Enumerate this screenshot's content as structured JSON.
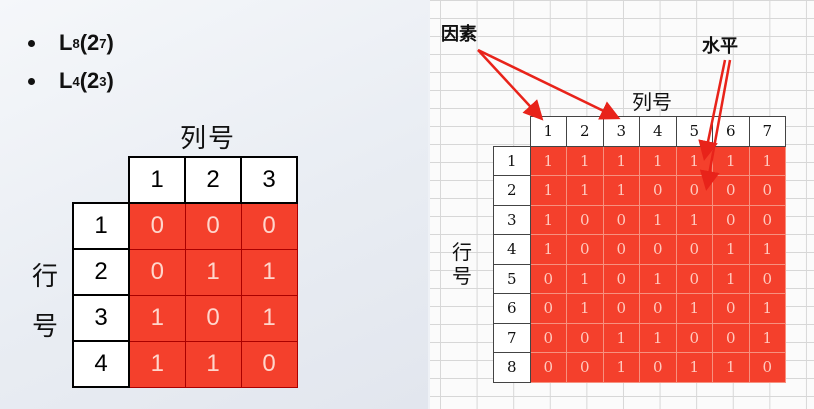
{
  "left": {
    "bullets": [
      {
        "base": "L",
        "sub": "8",
        "paren_base": "2",
        "sup": "7"
      },
      {
        "base": "L",
        "sub": "4",
        "paren_base": "2",
        "sup": "3"
      }
    ],
    "table_title": "列号",
    "row_label_1": "行",
    "row_label_2": "号",
    "columns": [
      "1",
      "2",
      "3"
    ],
    "rows": [
      {
        "id": "1",
        "values": [
          "0",
          "0",
          "0"
        ]
      },
      {
        "id": "2",
        "values": [
          "0",
          "1",
          "1"
        ]
      },
      {
        "id": "3",
        "values": [
          "1",
          "0",
          "1"
        ]
      },
      {
        "id": "4",
        "values": [
          "1",
          "1",
          "0"
        ]
      }
    ]
  },
  "right": {
    "factor_label": "因素",
    "level_label": "水平",
    "table_title": "列号",
    "row_label": "行号",
    "columns": [
      "1",
      "2",
      "3",
      "4",
      "5",
      "6",
      "7"
    ],
    "rows": [
      {
        "id": "1",
        "values": [
          "1",
          "1",
          "1",
          "1",
          "1",
          "1",
          "1"
        ]
      },
      {
        "id": "2",
        "values": [
          "1",
          "1",
          "1",
          "0",
          "0",
          "0",
          "0"
        ]
      },
      {
        "id": "3",
        "values": [
          "1",
          "0",
          "0",
          "1",
          "1",
          "0",
          "0"
        ]
      },
      {
        "id": "4",
        "values": [
          "1",
          "0",
          "0",
          "0",
          "0",
          "1",
          "1"
        ]
      },
      {
        "id": "5",
        "values": [
          "0",
          "1",
          "0",
          "1",
          "0",
          "1",
          "0"
        ]
      },
      {
        "id": "6",
        "values": [
          "0",
          "1",
          "0",
          "0",
          "1",
          "0",
          "1"
        ]
      },
      {
        "id": "7",
        "values": [
          "0",
          "0",
          "1",
          "1",
          "0",
          "0",
          "1"
        ]
      },
      {
        "id": "8",
        "values": [
          "0",
          "0",
          "1",
          "0",
          "1",
          "1",
          "0"
        ]
      }
    ]
  },
  "colors": {
    "cell_red": "#f4402c",
    "arrow_red": "#e8231a"
  }
}
